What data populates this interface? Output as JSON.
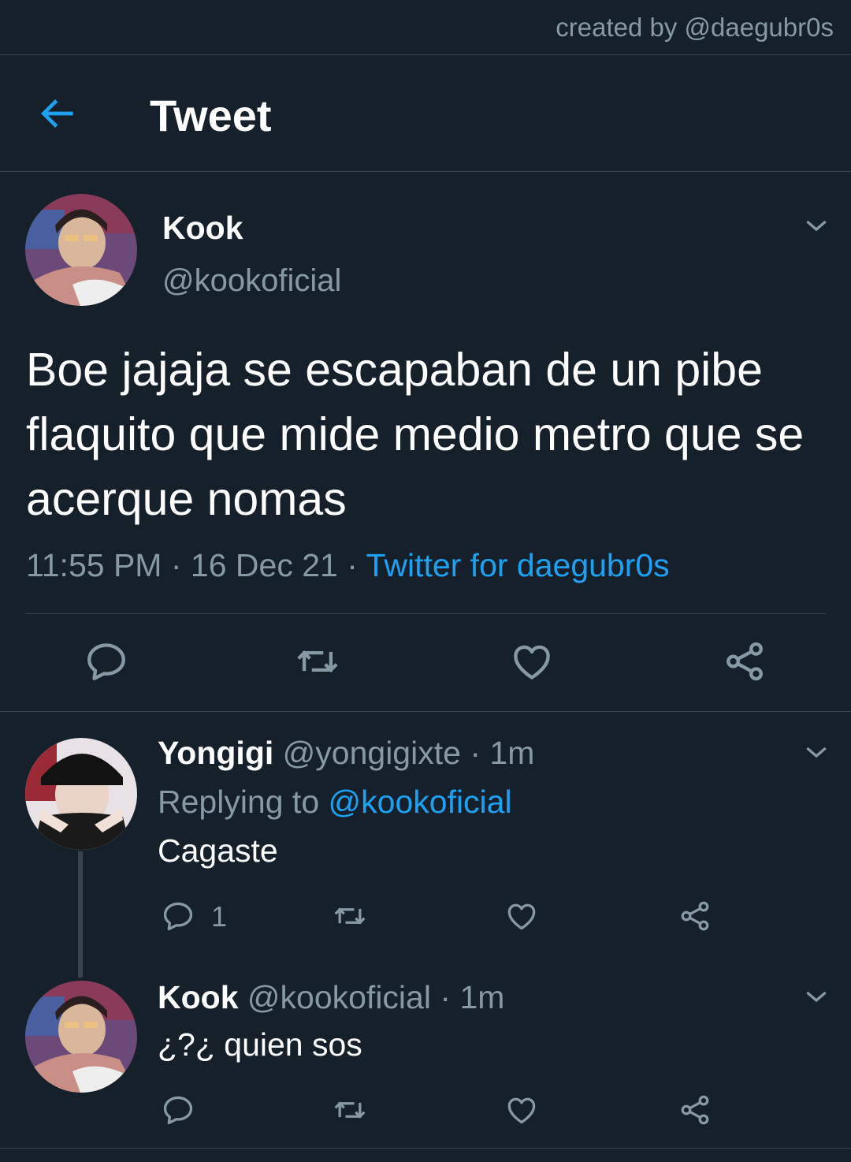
{
  "credit": "created by @daegubr0s",
  "header": {
    "title": "Tweet"
  },
  "main_tweet": {
    "name": "Kook",
    "handle": "@kookoficial",
    "text": "Boe jajaja se escapaban de un pibe flaquito que mide medio metro que se acerque nomas",
    "time": "11:55 PM",
    "date": "16 Dec 21",
    "source": "Twitter for daegubr0s"
  },
  "replies": [
    {
      "name": "Yongigi",
      "handle": "@yongigixte",
      "time": "1m",
      "replying_prefix": "Replying to",
      "replying_to": "@kookoficial",
      "text": "Cagaste",
      "reply_count": "1"
    },
    {
      "name": "Kook",
      "handle": "@kookoficial",
      "time": "1m",
      "text": "¿?¿ quien sos"
    }
  ],
  "separator": "·",
  "colors": {
    "background": "#15202b",
    "accent": "#1da1f2",
    "secondary_text": "#8899a6",
    "divider": "#38444d"
  },
  "icons": [
    "back-arrow-icon",
    "chevron-down-icon",
    "reply-icon",
    "retweet-icon",
    "like-icon",
    "share-icon"
  ]
}
